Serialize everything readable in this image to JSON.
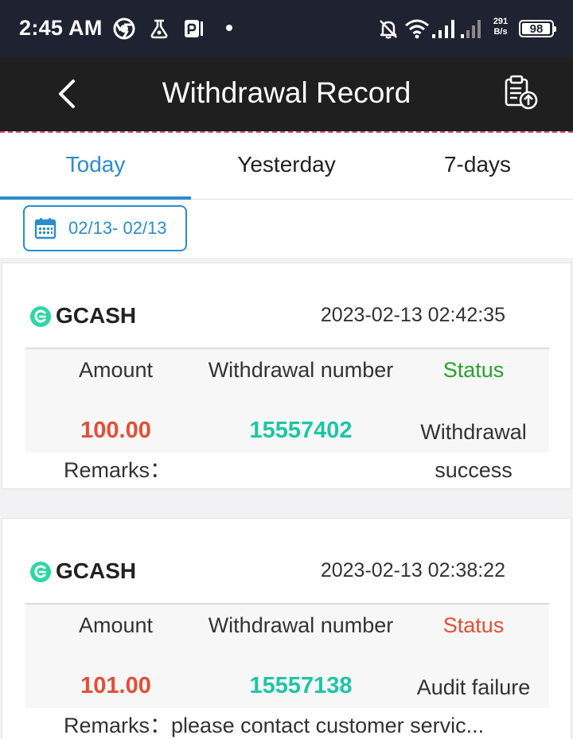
{
  "status_bar": {
    "time": "2:45 AM",
    "icons": [
      "chrome-icon",
      "app-icon",
      "parking-icon",
      "notification-dot",
      "mute-bell-icon",
      "wifi-icon",
      "signal-icon",
      "signal-icon"
    ],
    "net_speed_value": "291",
    "net_speed_unit": "B/s",
    "battery": "98",
    "battery_level": 0.98
  },
  "header": {
    "title": "Withdrawal Record",
    "back_icon": "chevron-left-icon",
    "action_icon": "clipboard-upload-icon"
  },
  "tabs": [
    {
      "label": "Today",
      "active": true
    },
    {
      "label": "Yesterday",
      "active": false
    },
    {
      "label": "7-days",
      "active": false
    }
  ],
  "filter": {
    "date_range": "02/13- 02/13",
    "icon": "calendar-icon"
  },
  "labels": {
    "amount": "Amount",
    "number": "Withdrawal number",
    "status": "Status",
    "remarks": "Remarks："
  },
  "records": [
    {
      "method": "GCASH",
      "datetime": "2023-02-13 02:42:35",
      "amount": "100.00",
      "number": "15557402",
      "status_line1": "Withdrawal",
      "status_line2": "success",
      "status_color": "#27a22d",
      "remarks": ""
    },
    {
      "method": "GCASH",
      "datetime": "2023-02-13 02:38:22",
      "amount": "101.00",
      "number": "15557138",
      "status_line1": "Audit failure",
      "status_line2": "",
      "status_color": "#e24f35",
      "remarks": "please contact customer servic..."
    }
  ],
  "colors": {
    "accent": "#2b8dc9",
    "amount": "#e24f35",
    "number": "#1ec5a4",
    "success": "#27a22d",
    "failure": "#e24f35"
  }
}
